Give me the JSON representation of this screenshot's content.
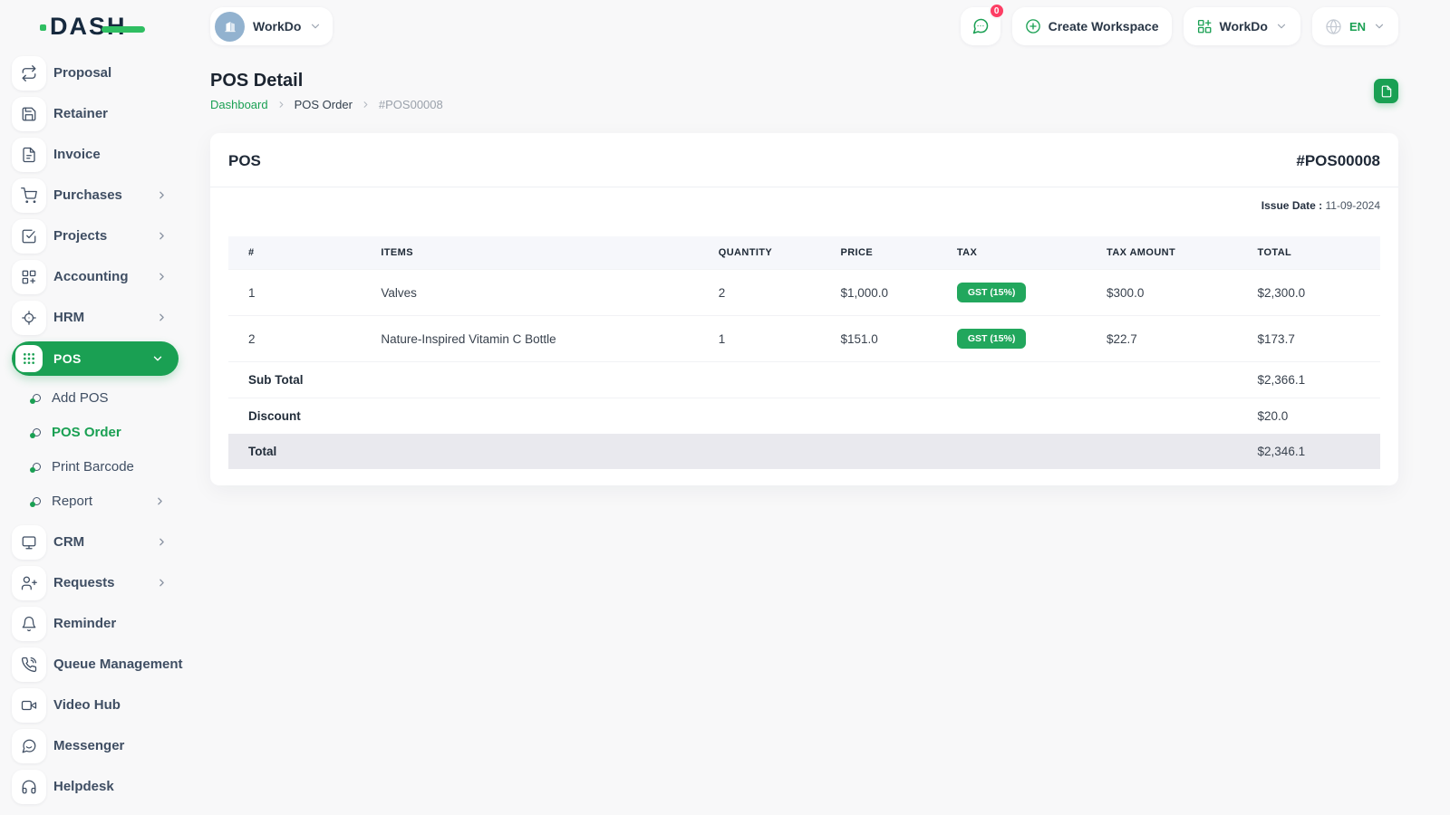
{
  "brand": {
    "name": "DASH"
  },
  "topbar": {
    "workspace": {
      "name": "WorkDo"
    },
    "messages": {
      "badge": "0"
    },
    "create_workspace_label": "Create Workspace",
    "company_menu_label": "WorkDo",
    "language": "EN"
  },
  "page": {
    "title": "POS Detail",
    "breadcrumb": {
      "home": "Dashboard",
      "section": "POS Order",
      "current": "#POS00008"
    }
  },
  "sidebar": {
    "top_items": [
      {
        "label": "Proposal",
        "has_children": false
      },
      {
        "label": "Retainer",
        "has_children": false
      },
      {
        "label": "Invoice",
        "has_children": false
      },
      {
        "label": "Purchases",
        "has_children": true
      },
      {
        "label": "Projects",
        "has_children": true
      },
      {
        "label": "Accounting",
        "has_children": true
      },
      {
        "label": "HRM",
        "has_children": true
      }
    ],
    "pos_group": {
      "label": "POS",
      "active": true,
      "children": [
        {
          "label": "Add POS",
          "active": false
        },
        {
          "label": "POS Order",
          "active": true
        },
        {
          "label": "Print Barcode",
          "active": false
        },
        {
          "label": "Report",
          "active": false,
          "has_children": true
        }
      ]
    },
    "bottom_items": [
      {
        "label": "CRM",
        "has_children": true
      },
      {
        "label": "Requests",
        "has_children": true
      },
      {
        "label": "Reminder",
        "has_children": false
      },
      {
        "label": "Queue Management",
        "has_children": true
      },
      {
        "label": "Video Hub",
        "has_children": false
      },
      {
        "label": "Messenger",
        "has_children": false
      },
      {
        "label": "Helpdesk",
        "has_children": false
      }
    ]
  },
  "invoice": {
    "title": "POS",
    "number": "#POS00008",
    "issue_date_label": "Issue Date :",
    "issue_date_value": "11-09-2024",
    "headers": [
      "#",
      "ITEMS",
      "QUANTITY",
      "PRICE",
      "TAX",
      "TAX AMOUNT",
      "TOTAL"
    ],
    "rows": [
      {
        "num": "1",
        "item": "Valves",
        "quantity": "2",
        "price": "$1,000.0",
        "tax": "GST (15%)",
        "tax_amount": "$300.0",
        "total": "$2,300.0"
      },
      {
        "num": "2",
        "item": "Nature-Inspired Vitamin C Bottle",
        "quantity": "1",
        "price": "$151.0",
        "tax": "GST (15%)",
        "tax_amount": "$22.7",
        "total": "$173.7"
      }
    ],
    "summary": {
      "sub_total_label": "Sub Total",
      "sub_total": "$2,366.1",
      "discount_label": "Discount",
      "discount": "$20.0",
      "total_label": "Total",
      "total": "$2,346.1"
    }
  },
  "icons": {
    "brand_accent_shapes": "green-dot-and-dash",
    "workspace_avatar": "building-icon",
    "topbar": [
      "chat-bubble-icon",
      "plus-circle-icon",
      "app-grid-icon",
      "globe-icon",
      "chevron-down-icon"
    ],
    "sidebar": [
      "repeat-icon",
      "save-icon",
      "file-icon",
      "cart-icon",
      "check-square-icon",
      "grid-plus-icon",
      "crosshair-icon",
      "dots-grid-icon",
      "monitor-icon",
      "user-plus-icon",
      "bell-icon",
      "phone-call-icon",
      "video-icon",
      "message-bubble-icon",
      "headphones-icon"
    ],
    "content": [
      "document-icon",
      "chevron-right-icon"
    ]
  },
  "colors": {
    "accent": "#1aa053",
    "badge_red": "#fd3e64",
    "page_bg": "#f8f8f9",
    "total_row_bg": "#e9e9ee"
  }
}
